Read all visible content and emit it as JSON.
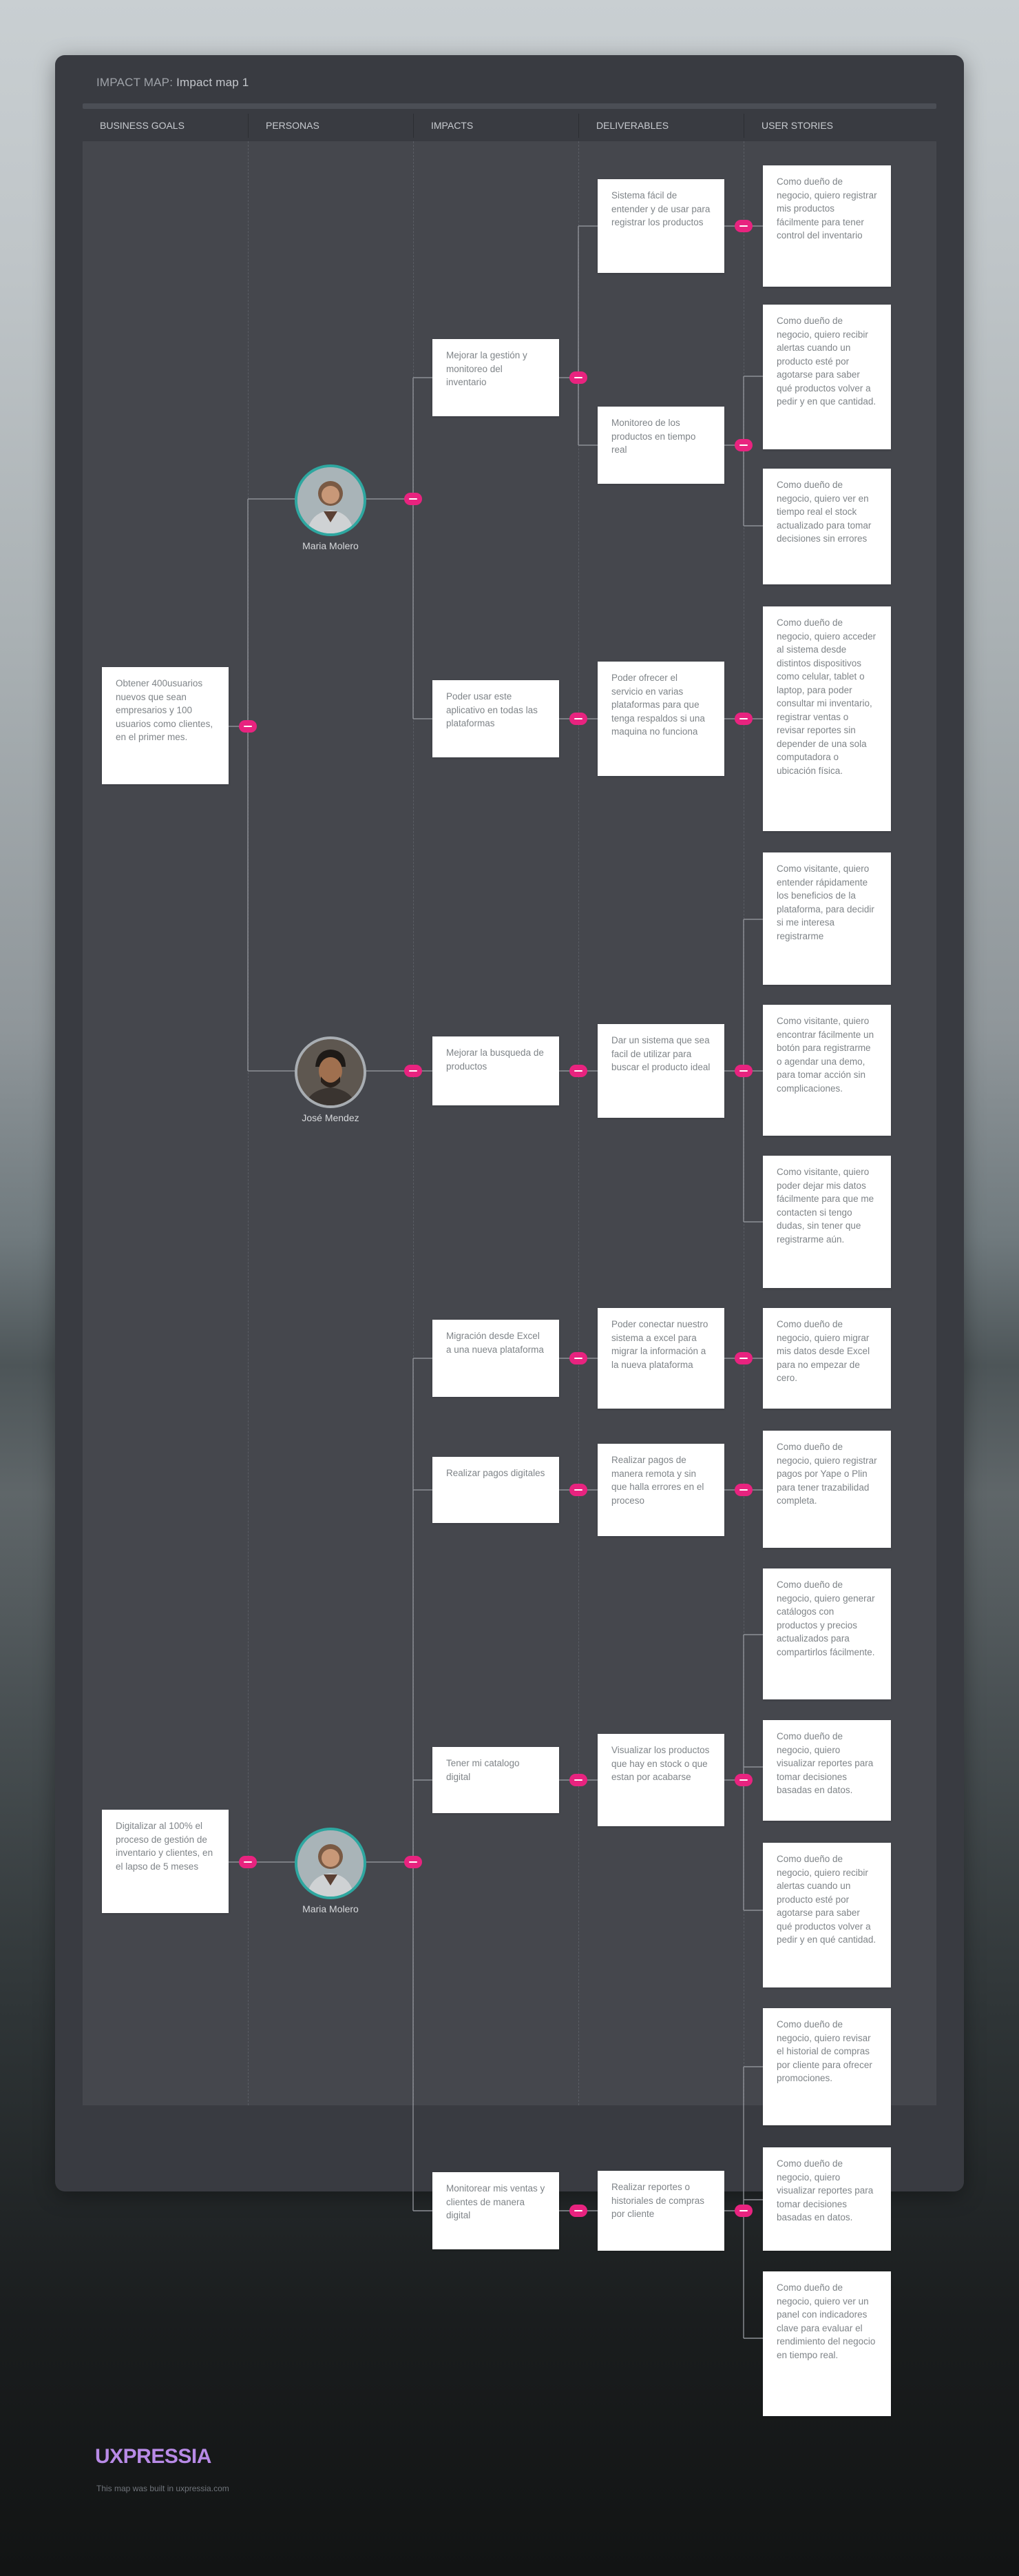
{
  "header": {
    "label": "IMPACT MAP:",
    "map_name": "Impact map 1",
    "columns": [
      "BUSINESS GOALS",
      "PERSONAS",
      "IMPACTS",
      "DELIVERABLES",
      "USER STORIES"
    ]
  },
  "goals": [
    {
      "text": "Obtener 400usuarios nuevos que sean empresarios  y 100 usuarios como clientes, en el primer mes."
    },
    {
      "text": "Digitalizar al 100% el proceso de gestión de inventario y clientes, en el lapso de 5 meses"
    }
  ],
  "personas": [
    {
      "name": "Maria Molero",
      "avatar": "woman-avatar-icon"
    },
    {
      "name": "José Mendez",
      "avatar": "man-avatar-icon"
    },
    {
      "name": "Maria Molero",
      "avatar": "woman-avatar-icon"
    }
  ],
  "impacts": [
    {
      "text": "Mejorar la gestión y monitoreo del inventario"
    },
    {
      "text": "Poder usar este aplicativo en todas las plataformas"
    },
    {
      "text": "Mejorar la busqueda de productos"
    },
    {
      "text": "Migración desde Excel a una nueva plataforma"
    },
    {
      "text": "Realizar pagos digitales"
    },
    {
      "text": "Tener mi catalogo digital"
    },
    {
      "text": "Monitorear mis ventas y clientes de manera digital"
    }
  ],
  "deliverables": [
    {
      "text": "Sistema fácil de entender y de usar para registrar los productos"
    },
    {
      "text": "Monitoreo de los productos en tiempo real"
    },
    {
      "text": "Poder ofrecer el servicio en varias plataformas para que tenga respaldos si una maquina no funciona"
    },
    {
      "text": "Dar un sistema que sea facil de utilizar para buscar el producto ideal"
    },
    {
      "text": "Poder conectar nuestro sistema a excel para migrar la información a la nueva plataforma"
    },
    {
      "text": "Realizar pagos de manera remota y sin que halla errores en el proceso"
    },
    {
      "text": "Visualizar los productos que hay en stock o que estan por acabarse"
    },
    {
      "text": "Realizar reportes o historiales de compras por cliente"
    }
  ],
  "stories": [
    {
      "text": "Como dueño de negocio, quiero registrar mis productos fácilmente para tener control del inventario"
    },
    {
      "text": "Como dueño de negocio, quiero recibir alertas cuando un producto esté por agotarse para saber qué productos volver a pedir y en que cantidad."
    },
    {
      "text": "Como dueño de negocio, quiero ver en tiempo real el stock actualizado para tomar decisiones sin errores"
    },
    {
      "text": "Como dueño de negocio, quiero acceder al sistema desde distintos dispositivos como celular, tablet o laptop, para poder consultar mi inventario, registrar ventas o revisar reportes sin depender de una sola computadora o ubicación física."
    },
    {
      "text": "Como visitante, quiero entender rápidamente los beneficios de la plataforma, para decidir si me interesa registrarme"
    },
    {
      "text": "Como visitante, quiero encontrar fácilmente un botón para registrarme o agendar una demo, para tomar acción sin complicaciones."
    },
    {
      "text": "Como visitante, quiero poder dejar mis datos fácilmente para que me contacten si tengo dudas, sin tener que registrarme aún."
    },
    {
      "text": "Como dueño de negocio, quiero migrar mis datos desde Excel para no empezar de cero."
    },
    {
      "text": "Como dueño de negocio, quiero registrar pagos por Yape o Plin para tener trazabilidad completa."
    },
    {
      "text": "Como dueño de negocio, quiero generar catálogos con productos y precios actualizados para compartirlos fácilmente."
    },
    {
      "text": "Como dueño de negocio, quiero visualizar reportes para tomar decisiones basadas en datos."
    },
    {
      "text": "Como dueño de negocio, quiero recibir alertas cuando un producto esté por agotarse para saber qué productos volver a pedir y en qué cantidad."
    },
    {
      "text": "Como dueño de negocio, quiero revisar el historial de compras por cliente para ofrecer promociones."
    },
    {
      "text": "Como dueño de negocio, quiero visualizar reportes para tomar decisiones basadas en datos."
    },
    {
      "text": "Como dueño de negocio, quiero ver un panel con indicadores clave para evaluar el rendimiento del negocio en tiempo real."
    }
  ],
  "footer": {
    "brand": "UXPRESSIA",
    "built_with": "This map was built in uxpressia.com"
  },
  "colors": {
    "panel": "#393b41",
    "column_bg": "#45474d",
    "accent_dot": "#e8237f",
    "brand": "#b88ae6",
    "avatar_ring": "#2ea7a0"
  }
}
